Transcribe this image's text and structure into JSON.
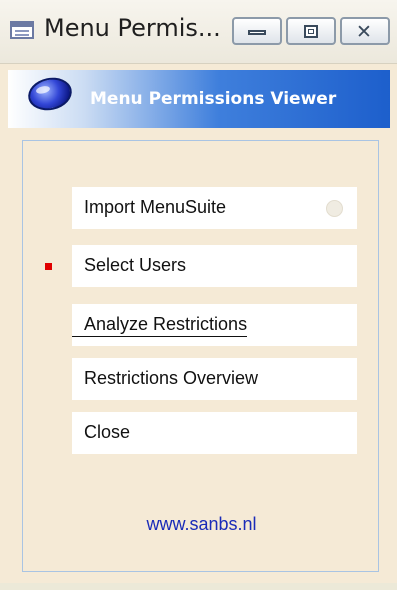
{
  "window": {
    "title": "Menu Permis...",
    "buttons": {
      "minimize_icon": "minimize-icon",
      "maximize_icon": "maximize-icon",
      "close_icon": "close-icon"
    }
  },
  "banner": {
    "title": "Menu Permissions Viewer",
    "logo": "globe-logo"
  },
  "menu": {
    "items": [
      {
        "label": "Import MenuSuite",
        "status_indicator": "inactive"
      },
      {
        "label": "Select Users",
        "selected_marker": true
      },
      {
        "label": "Analyze Restrictions",
        "focused": true
      },
      {
        "label": "Restrictions Overview"
      },
      {
        "label": "Close"
      }
    ]
  },
  "footer": {
    "link": "www.sanbs.nl"
  },
  "colors": {
    "banner_blue": "#1d5fcc",
    "marker_red": "#e00000",
    "link_blue": "#1a2bb8",
    "background": "#f5ead6"
  }
}
